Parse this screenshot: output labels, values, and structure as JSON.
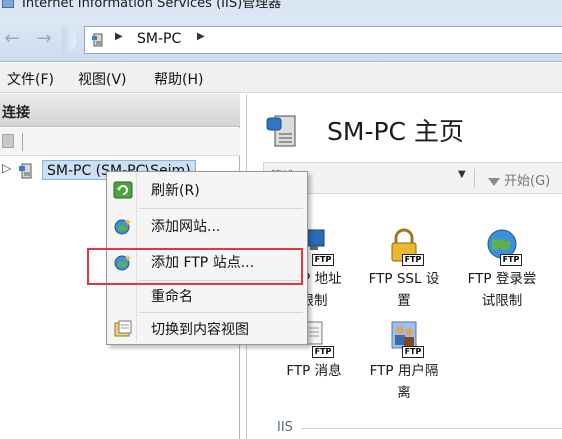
{
  "window": {
    "title": "Internet Information Services (IIS)管理器"
  },
  "address": {
    "segment": "SM-PC"
  },
  "menu": {
    "file": "文件(F)",
    "view": "视图(V)",
    "help": "帮助(H)"
  },
  "connections": {
    "header": "连接",
    "tree_item": "SM-PC (SM-PC\\Seim)"
  },
  "main": {
    "title": "SM-PC 主页",
    "filter_placeholder": "筛选:",
    "start_label": "开始(G)",
    "features": [
      {
        "label": "FTP 地址\n限制"
      },
      {
        "label": "FTP SSL 设\n置"
      },
      {
        "label": "FTP 登录尝\n试限制"
      },
      {
        "label": "FTP 消息"
      },
      {
        "label": "FTP 用户隔\n离"
      }
    ],
    "group_label": "IIS"
  },
  "context_menu": {
    "items": [
      {
        "label": "刷新(R)",
        "icon": "refresh-icon"
      },
      {
        "label": "添加网站...",
        "icon": "globe-add-icon"
      },
      {
        "label": "添加 FTP 站点...",
        "icon": "globe-add-ftp-icon"
      },
      {
        "label": "重命名",
        "icon": "none"
      },
      {
        "label": "切换到内容视图",
        "icon": "content-view-icon"
      }
    ]
  },
  "colors": {
    "highlight": "#e0383e",
    "selection": "#ccdff5"
  }
}
